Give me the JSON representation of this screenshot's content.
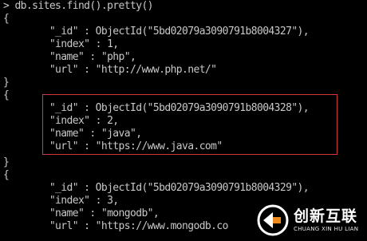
{
  "console": {
    "command": "> db.sites.find().pretty()",
    "lines": [
      "{",
      "        \"_id\" : ObjectId(\"5bd02079a3090791b8004327\"),",
      "        \"index\" : 1,",
      "        \"name\" : \"php\",",
      "        \"url\" : \"http://www.php.net/\"",
      "}",
      "{",
      "        \"_id\" : ObjectId(\"5bd02079a3090791b8004328\"),",
      "        \"index\" : 2,",
      "        \"name\" : \"java\",",
      "        \"url\" : \"https://www.java.com\"",
      "}",
      "{",
      "        \"_id\" : ObjectId(\"5bd02079a3090791b8004329\"),",
      "        \"index\" : 3,",
      "        \"name\" : \"mongodb\",",
      "        \"url\" : \"https://www.mongodb.co"
    ]
  },
  "watermark": {
    "main": "创新互联",
    "sub": "CHUANG XIN HU LIAN"
  },
  "colors": {
    "background": "#000000",
    "text": "#c8c8c8",
    "highlight_border": "#d23a3a",
    "logo_accent": "#f08a1c"
  },
  "icons": {
    "watermark_logo": "brand-logo-icon"
  }
}
